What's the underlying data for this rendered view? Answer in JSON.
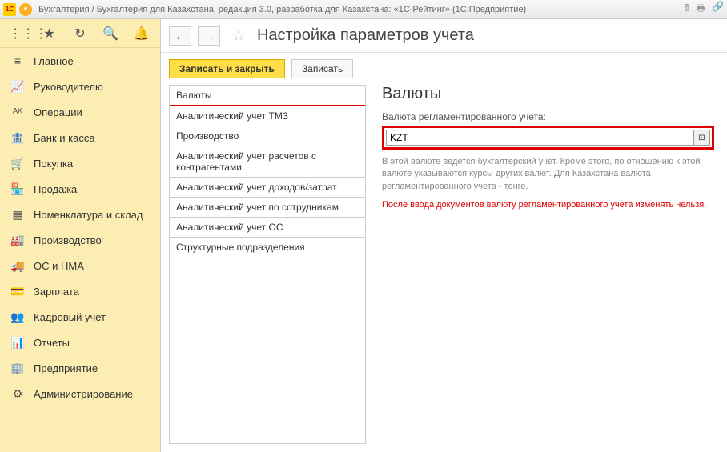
{
  "titlebar": {
    "logo_text": "1C",
    "title": "Бухгалтерия / Бухгалтерия для Казахстана, редакция 3.0, разработка для Казахстана: «1С-Рейтинг»   (1С:Предприятие)"
  },
  "sidebar": {
    "items": [
      {
        "icon": "≡",
        "label": "Главное"
      },
      {
        "icon": "📈",
        "label": "Руководителю"
      },
      {
        "icon": "ᴬᴷ",
        "label": "Операции"
      },
      {
        "icon": "🏦",
        "label": "Банк и касса"
      },
      {
        "icon": "🛒",
        "label": "Покупка"
      },
      {
        "icon": "🏪",
        "label": "Продажа"
      },
      {
        "icon": "▦",
        "label": "Номенклатура и склад"
      },
      {
        "icon": "🏭",
        "label": "Производство"
      },
      {
        "icon": "🚚",
        "label": "ОС и НМА"
      },
      {
        "icon": "💳",
        "label": "Зарплата"
      },
      {
        "icon": "👥",
        "label": "Кадровый учет"
      },
      {
        "icon": "📊",
        "label": "Отчеты"
      },
      {
        "icon": "🏢",
        "label": "Предприятие"
      },
      {
        "icon": "⚙",
        "label": "Администрирование"
      }
    ]
  },
  "page": {
    "title": "Настройка параметров учета"
  },
  "toolbar": {
    "save_close": "Записать и закрыть",
    "save": "Записать"
  },
  "tabs": [
    "Валюты",
    "Аналитический учет ТМЗ",
    "Производство",
    "Аналитический учет расчетов с контрагентами",
    "Аналитический учет доходов/затрат",
    "Аналитический учет по сотрудникам",
    "Аналитический учет ОС",
    "Структурные подразделения"
  ],
  "details": {
    "heading": "Валюты",
    "field_label": "Валюта регламентированного учета:",
    "currency_value": "KZT",
    "help": "В этой валюте ведется бухгалтерский учет. Кроме этого, по отношению к этой валюте указываются курсы других валют. Для Казахстана валюта регламентированного учета - тенге.",
    "warning": "После ввода документов валюту регламентированного учета изменять нельзя."
  }
}
